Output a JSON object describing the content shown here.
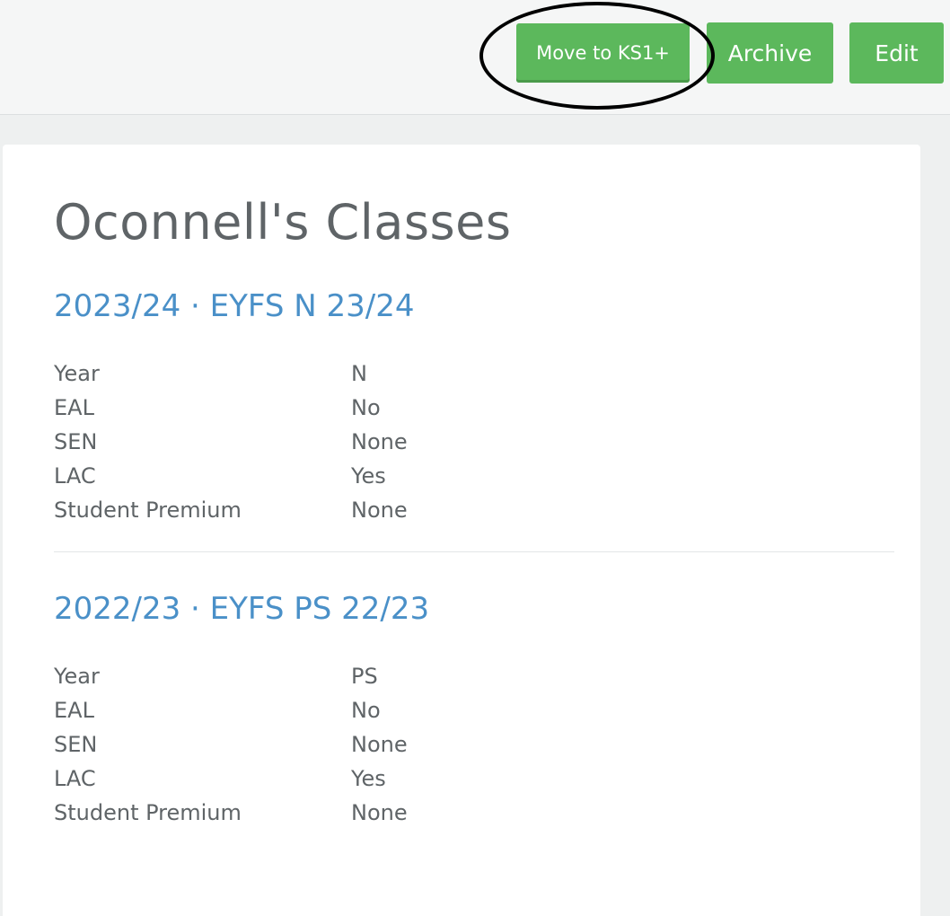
{
  "toolbar": {
    "move_label": "Move to KS1+",
    "archive_label": "Archive",
    "edit_label": "Edit"
  },
  "colors": {
    "button_green": "#5cb85c",
    "link_blue": "#4a90c8",
    "text_gray": "#5f6467"
  },
  "page": {
    "title": "Oconnell's Classes"
  },
  "classes": [
    {
      "heading": "2023/24 · EYFS N 23/24",
      "rows": [
        {
          "label": "Year",
          "value": "N"
        },
        {
          "label": "EAL",
          "value": "No"
        },
        {
          "label": "SEN",
          "value": "None"
        },
        {
          "label": "LAC",
          "value": "Yes"
        },
        {
          "label": "Student Premium",
          "value": "None"
        }
      ]
    },
    {
      "heading": "2022/23 · EYFS PS 22/23",
      "rows": [
        {
          "label": "Year",
          "value": "PS"
        },
        {
          "label": "EAL",
          "value": "No"
        },
        {
          "label": "SEN",
          "value": "None"
        },
        {
          "label": "LAC",
          "value": "Yes"
        },
        {
          "label": "Student Premium",
          "value": "None"
        }
      ]
    }
  ]
}
